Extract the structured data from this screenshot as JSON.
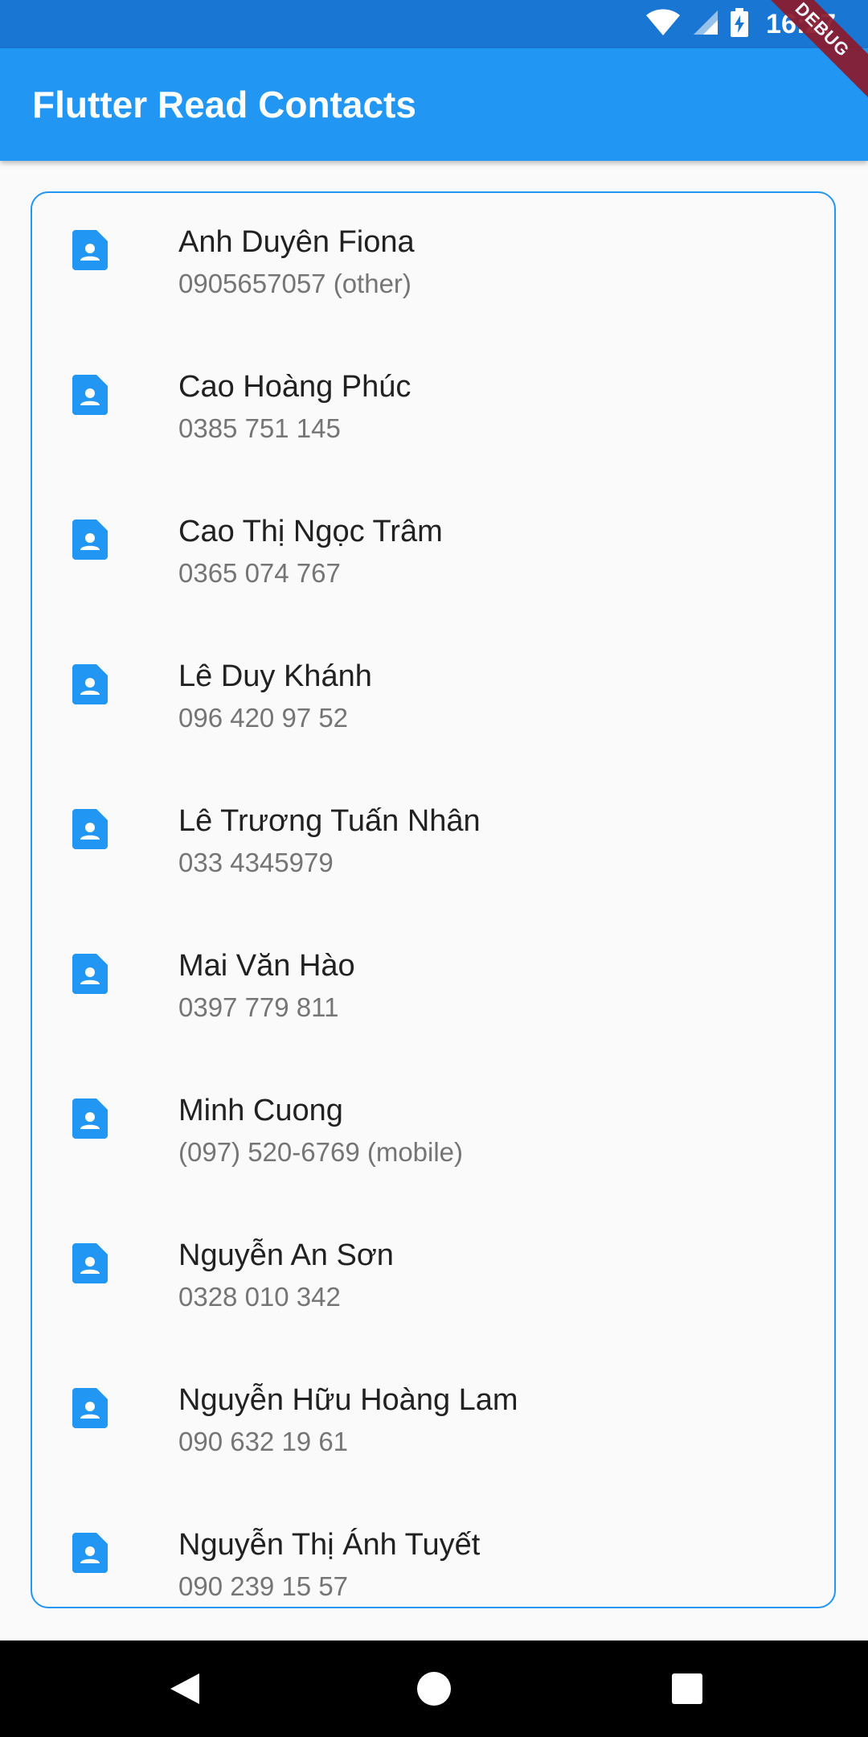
{
  "status_bar": {
    "time": "16:27",
    "icons": [
      "wifi-icon",
      "cell-signal-icon",
      "battery-charging-icon"
    ],
    "debug_banner": "DEBUG"
  },
  "app_bar": {
    "title": "Flutter Read Contacts"
  },
  "contacts": [
    {
      "name": "Anh Duyên Fiona",
      "phone": "0905657057 (other)"
    },
    {
      "name": "Cao Hoàng Phúc",
      "phone": "0385 751 145"
    },
    {
      "name": "Cao Thị Ngọc Trâm",
      "phone": "0365 074 767"
    },
    {
      "name": "Lê Duy Khánh",
      "phone": "096 420 97 52"
    },
    {
      "name": "Lê Trương Tuấn Nhân",
      "phone": "033 4345979"
    },
    {
      "name": "Mai Văn Hào",
      "phone": "0397 779 811"
    },
    {
      "name": "Minh Cuong",
      "phone": "(097) 520-6769 (mobile)"
    },
    {
      "name": "Nguyễn An Sơn",
      "phone": "0328 010 342"
    },
    {
      "name": "Nguyễn Hữu Hoàng Lam",
      "phone": "090 632 19 61"
    },
    {
      "name": "Nguyễn Thị Ánh Tuyết",
      "phone": "090 239 15 57"
    }
  ],
  "nav_bar": {
    "buttons": [
      "back-icon",
      "home-icon",
      "recents-icon"
    ]
  },
  "colors": {
    "status_bar": "#1976d2",
    "app_bar": "#2196f3",
    "accent": "#2196f3"
  }
}
